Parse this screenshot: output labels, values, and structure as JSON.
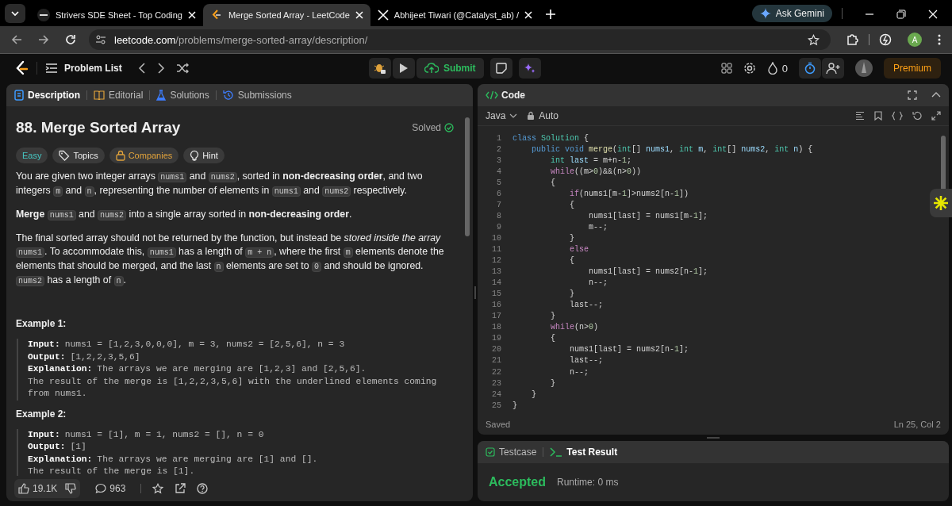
{
  "browser": {
    "tabs": [
      {
        "title": "Strivers SDE Sheet - Top Coding",
        "selected": false
      },
      {
        "title": "Merge Sorted Array - LeetCode",
        "selected": true
      },
      {
        "title": "Abhijeet Tiwari (@Catalyst_ab) /",
        "selected": false
      }
    ],
    "gemini": "Ask Gemini",
    "url": {
      "host": "leetcode.com",
      "path": "/problems/merge-sorted-array/description/"
    },
    "avatar": "A"
  },
  "nav": {
    "problem_list": "Problem List",
    "submit": "Submit",
    "streak": "0",
    "premium": "Premium"
  },
  "left_tabs": [
    {
      "label": "Description",
      "selected": true
    },
    {
      "label": "Editorial",
      "selected": false
    },
    {
      "label": "Solutions",
      "selected": false
    },
    {
      "label": "Submissions",
      "selected": false
    }
  ],
  "problem": {
    "title": "88. Merge Sorted Array",
    "status": "Solved",
    "tags": [
      {
        "label": "Easy",
        "kind": "difficulty"
      },
      {
        "label": "Topics",
        "kind": "topics"
      },
      {
        "label": "Companies",
        "kind": "companies"
      },
      {
        "label": "Hint",
        "kind": "hint"
      }
    ],
    "paragraphs": [
      [
        {
          "text": "You are given two integer arrays ",
          "kind": "text"
        },
        {
          "text": "nums1",
          "kind": "code"
        },
        {
          "text": " and ",
          "kind": "text"
        },
        {
          "text": "nums2",
          "kind": "code"
        },
        {
          "text": ", sorted in ",
          "kind": "text"
        },
        {
          "text": "non-decreasing order",
          "kind": "bold"
        },
        {
          "text": ", and two integers ",
          "kind": "text"
        },
        {
          "text": "m",
          "kind": "code"
        },
        {
          "text": " and ",
          "kind": "text"
        },
        {
          "text": "n",
          "kind": "code"
        },
        {
          "text": ", representing the number of elements in ",
          "kind": "text"
        },
        {
          "text": "nums1",
          "kind": "code"
        },
        {
          "text": " and ",
          "kind": "text"
        },
        {
          "text": "nums2",
          "kind": "code"
        },
        {
          "text": " respectively.",
          "kind": "text"
        }
      ],
      [
        {
          "text": "Merge ",
          "kind": "bold"
        },
        {
          "text": "nums1",
          "kind": "code"
        },
        {
          "text": " and ",
          "kind": "text"
        },
        {
          "text": "nums2",
          "kind": "code"
        },
        {
          "text": " into a single array sorted in ",
          "kind": "text"
        },
        {
          "text": "non-decreasing order",
          "kind": "bold"
        },
        {
          "text": ".",
          "kind": "text"
        }
      ],
      [
        {
          "text": "The final sorted array should not be returned by the function, but instead be ",
          "kind": "text"
        },
        {
          "text": "stored inside the array ",
          "kind": "italic"
        },
        {
          "text": "nums1",
          "kind": "code"
        },
        {
          "text": ". To accommodate this, ",
          "kind": "text"
        },
        {
          "text": "nums1",
          "kind": "code"
        },
        {
          "text": " has a length of ",
          "kind": "text"
        },
        {
          "text": "m + n",
          "kind": "code"
        },
        {
          "text": ", where the first ",
          "kind": "text"
        },
        {
          "text": "m",
          "kind": "code"
        },
        {
          "text": " elements denote the elements that should be merged, and the last ",
          "kind": "text"
        },
        {
          "text": "n",
          "kind": "code"
        },
        {
          "text": " elements are set to ",
          "kind": "text"
        },
        {
          "text": "0",
          "kind": "code"
        },
        {
          "text": " and should be ignored. ",
          "kind": "text"
        },
        {
          "text": "nums2",
          "kind": "code"
        },
        {
          "text": " has a length of ",
          "kind": "text"
        },
        {
          "text": "n",
          "kind": "code"
        },
        {
          "text": ".",
          "kind": "text"
        }
      ]
    ],
    "examples": [
      {
        "title": "Example 1:",
        "lines": [
          {
            "label": "Input:",
            "value": "nums1 = [1,2,3,0,0,0], m = 3, nums2 = [2,5,6], n = 3"
          },
          {
            "label": "Output:",
            "value": "[1,2,2,3,5,6]"
          },
          {
            "label": "Explanation:",
            "value": "The arrays we are merging are [1,2,3] and [2,5,6]."
          },
          {
            "value": "The result of the merge is [1,2,2,3,5,6] with the underlined elements coming from nums1."
          }
        ]
      },
      {
        "title": "Example 2:",
        "lines": [
          {
            "label": "Input:",
            "value": "nums1 = [1], m = 1, nums2 = [], n = 0"
          },
          {
            "label": "Output:",
            "value": "[1]"
          },
          {
            "label": "Explanation:",
            "value": "The arrays we are merging are [1] and []."
          },
          {
            "value": "The result of the merge is [1]."
          }
        ]
      }
    ]
  },
  "footer": {
    "likes": "19.1K",
    "comments": "963"
  },
  "code": {
    "title": "Code",
    "language": "Java",
    "mode": "Auto",
    "status": "Saved",
    "cursor": "Ln 25, Col 2",
    "lines": [
      {
        "number": "1",
        "tokens": [
          {
            "text": "class ",
            "kind": "keyword"
          },
          {
            "text": "Solution",
            "kind": "type"
          },
          {
            "text": " {",
            "kind": "plain"
          }
        ]
      },
      {
        "number": "2",
        "tokens": [
          {
            "text": "    public void ",
            "kind": "keyword"
          },
          {
            "text": "merge",
            "kind": "function"
          },
          {
            "text": "(",
            "kind": "plain"
          },
          {
            "text": "int",
            "kind": "type"
          },
          {
            "text": "[] ",
            "kind": "plain"
          },
          {
            "text": "nums1",
            "kind": "param"
          },
          {
            "text": ", ",
            "kind": "plain"
          },
          {
            "text": "int",
            "kind": "type"
          },
          {
            "text": " m",
            "kind": "param"
          },
          {
            "text": ", ",
            "kind": "plain"
          },
          {
            "text": "int",
            "kind": "type"
          },
          {
            "text": "[] ",
            "kind": "plain"
          },
          {
            "text": "nums2",
            "kind": "param"
          },
          {
            "text": ", ",
            "kind": "plain"
          },
          {
            "text": "int",
            "kind": "type"
          },
          {
            "text": " n",
            "kind": "param"
          },
          {
            "text": ") {",
            "kind": "plain"
          }
        ]
      },
      {
        "number": "3",
        "tokens": [
          {
            "text": "        int",
            "kind": "type"
          },
          {
            "text": " last",
            "kind": "param"
          },
          {
            "text": " = m+n-",
            "kind": "plain"
          },
          {
            "text": "1",
            "kind": "number"
          },
          {
            "text": ";",
            "kind": "plain"
          }
        ]
      },
      {
        "number": "4",
        "tokens": [
          {
            "text": "        while",
            "kind": "control"
          },
          {
            "text": "((m>",
            "kind": "plain"
          },
          {
            "text": "0",
            "kind": "number"
          },
          {
            "text": ")&&(n>",
            "kind": "plain"
          },
          {
            "text": "0",
            "kind": "number"
          },
          {
            "text": "))",
            "kind": "plain"
          }
        ]
      },
      {
        "number": "5",
        "tokens": [
          {
            "text": "        {",
            "kind": "plain"
          }
        ]
      },
      {
        "number": "6",
        "tokens": [
          {
            "text": "            if",
            "kind": "control"
          },
          {
            "text": "(nums1[m-",
            "kind": "plain"
          },
          {
            "text": "1",
            "kind": "number"
          },
          {
            "text": "]>nums2[n-",
            "kind": "plain"
          },
          {
            "text": "1",
            "kind": "number"
          },
          {
            "text": "])",
            "kind": "plain"
          }
        ]
      },
      {
        "number": "7",
        "tokens": [
          {
            "text": "            {",
            "kind": "plain"
          }
        ]
      },
      {
        "number": "8",
        "tokens": [
          {
            "text": "                nums1[last] = nums1[m-",
            "kind": "plain"
          },
          {
            "text": "1",
            "kind": "number"
          },
          {
            "text": "];",
            "kind": "plain"
          }
        ]
      },
      {
        "number": "9",
        "tokens": [
          {
            "text": "                m--;",
            "kind": "plain"
          }
        ]
      },
      {
        "number": "10",
        "tokens": [
          {
            "text": "            }",
            "kind": "plain"
          }
        ]
      },
      {
        "number": "11",
        "tokens": [
          {
            "text": "            else",
            "kind": "control"
          }
        ]
      },
      {
        "number": "12",
        "tokens": [
          {
            "text": "            {",
            "kind": "plain"
          }
        ]
      },
      {
        "number": "13",
        "tokens": [
          {
            "text": "                nums1[last] = nums2[n-",
            "kind": "plain"
          },
          {
            "text": "1",
            "kind": "number"
          },
          {
            "text": "];",
            "kind": "plain"
          }
        ]
      },
      {
        "number": "14",
        "tokens": [
          {
            "text": "                n--;",
            "kind": "plain"
          }
        ]
      },
      {
        "number": "15",
        "tokens": [
          {
            "text": "            }",
            "kind": "plain"
          }
        ]
      },
      {
        "number": "16",
        "tokens": [
          {
            "text": "            last--;",
            "kind": "plain"
          }
        ]
      },
      {
        "number": "17",
        "tokens": [
          {
            "text": "        }",
            "kind": "plain"
          }
        ]
      },
      {
        "number": "18",
        "tokens": [
          {
            "text": "        while",
            "kind": "control"
          },
          {
            "text": "(n>",
            "kind": "plain"
          },
          {
            "text": "0",
            "kind": "number"
          },
          {
            "text": ")",
            "kind": "plain"
          }
        ]
      },
      {
        "number": "19",
        "tokens": [
          {
            "text": "        {",
            "kind": "plain"
          }
        ]
      },
      {
        "number": "20",
        "tokens": [
          {
            "text": "            nums1[last] = nums2[n-",
            "kind": "plain"
          },
          {
            "text": "1",
            "kind": "number"
          },
          {
            "text": "];",
            "kind": "plain"
          }
        ]
      },
      {
        "number": "21",
        "tokens": [
          {
            "text": "            last--;",
            "kind": "plain"
          }
        ]
      },
      {
        "number": "22",
        "tokens": [
          {
            "text": "            n--;",
            "kind": "plain"
          }
        ]
      },
      {
        "number": "23",
        "tokens": [
          {
            "text": "        }",
            "kind": "plain"
          }
        ]
      },
      {
        "number": "24",
        "tokens": [
          {
            "text": "    }",
            "kind": "plain"
          }
        ]
      },
      {
        "number": "25",
        "tokens": [
          {
            "text": "}",
            "kind": "plain"
          }
        ]
      }
    ]
  },
  "result": {
    "tabs": [
      {
        "label": "Testcase",
        "selected": false
      },
      {
        "label": "Test Result",
        "selected": true
      }
    ],
    "verdict": "Accepted",
    "runtime": "Runtime: 0 ms"
  }
}
